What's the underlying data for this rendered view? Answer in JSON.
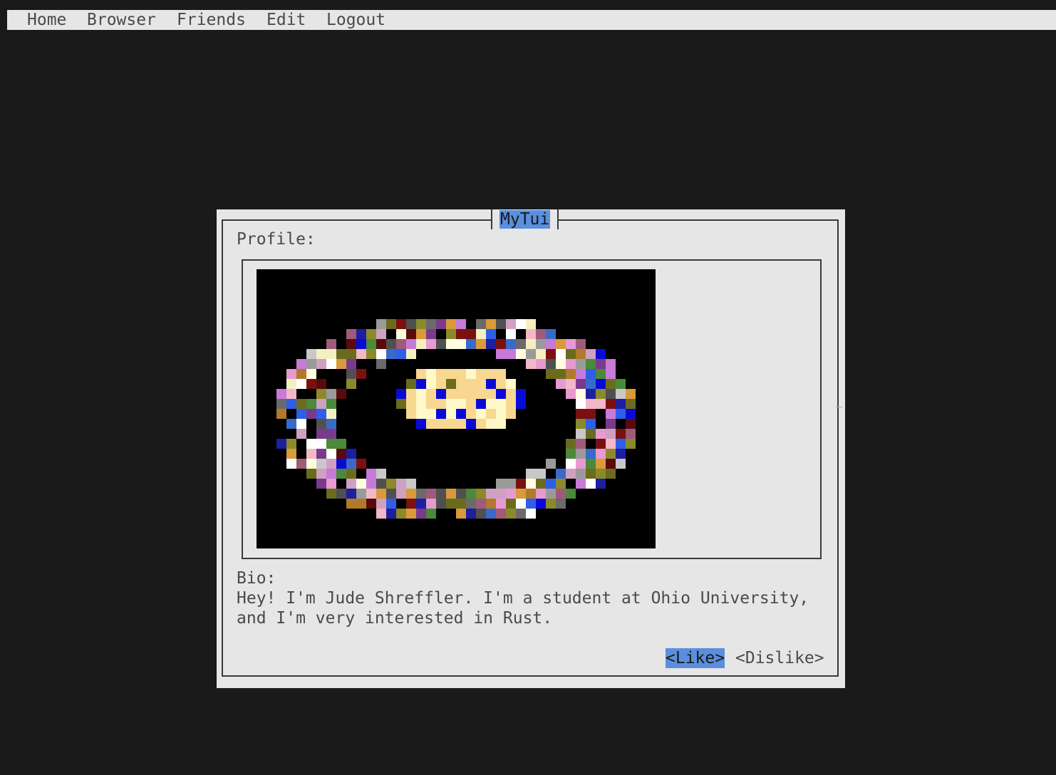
{
  "menu": {
    "items": [
      {
        "label": "Home"
      },
      {
        "label": "Browser"
      },
      {
        "label": "Friends"
      },
      {
        "label": "Edit"
      },
      {
        "label": "Logout"
      }
    ]
  },
  "dialog": {
    "title": "MyTui",
    "profile_label": "Profile:",
    "bio_label": "Bio:",
    "bio_text": "Hey! I'm Jude Shreffler. I'm a student at Ohio University,\nand I'm very interested in Rust.",
    "like_label": "<Like>",
    "dislike_label": "<Dislike>"
  },
  "colors": {
    "background": "#1a1a1a",
    "panel": "#e6e6e6",
    "highlight": "#5a8fde",
    "text": "#4a4a4a"
  }
}
